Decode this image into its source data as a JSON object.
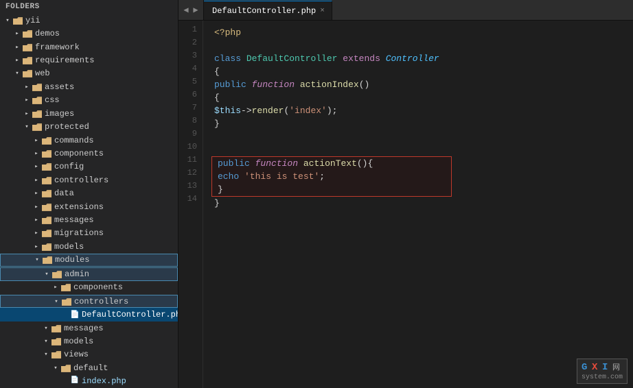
{
  "sidebar": {
    "header": "FOLDERS",
    "tree": [
      {
        "id": "yii",
        "label": "yii",
        "indent": 0,
        "type": "folder",
        "state": "expanded"
      },
      {
        "id": "demos",
        "label": "demos",
        "indent": 1,
        "type": "folder",
        "state": "collapsed"
      },
      {
        "id": "framework",
        "label": "framework",
        "indent": 1,
        "type": "folder",
        "state": "collapsed"
      },
      {
        "id": "requirements",
        "label": "requirements",
        "indent": 1,
        "type": "folder",
        "state": "collapsed"
      },
      {
        "id": "web",
        "label": "web",
        "indent": 1,
        "type": "folder",
        "state": "expanded"
      },
      {
        "id": "assets",
        "label": "assets",
        "indent": 2,
        "type": "folder",
        "state": "collapsed"
      },
      {
        "id": "css",
        "label": "css",
        "indent": 2,
        "type": "folder",
        "state": "collapsed"
      },
      {
        "id": "images",
        "label": "images",
        "indent": 2,
        "type": "folder",
        "state": "collapsed"
      },
      {
        "id": "protected",
        "label": "protected",
        "indent": 2,
        "type": "folder",
        "state": "expanded"
      },
      {
        "id": "commands",
        "label": "commands",
        "indent": 3,
        "type": "folder",
        "state": "collapsed"
      },
      {
        "id": "components",
        "label": "components",
        "indent": 3,
        "type": "folder",
        "state": "collapsed"
      },
      {
        "id": "config",
        "label": "config",
        "indent": 3,
        "type": "folder",
        "state": "collapsed"
      },
      {
        "id": "controllers",
        "label": "controllers",
        "indent": 3,
        "type": "folder",
        "state": "collapsed"
      },
      {
        "id": "data",
        "label": "data",
        "indent": 3,
        "type": "folder",
        "state": "collapsed"
      },
      {
        "id": "extensions",
        "label": "extensions",
        "indent": 3,
        "type": "folder",
        "state": "collapsed"
      },
      {
        "id": "messages",
        "label": "messages",
        "indent": 3,
        "type": "folder",
        "state": "collapsed"
      },
      {
        "id": "migrations",
        "label": "migrations",
        "indent": 3,
        "type": "folder",
        "state": "collapsed"
      },
      {
        "id": "models",
        "label": "models",
        "indent": 3,
        "type": "folder",
        "state": "collapsed"
      },
      {
        "id": "modules",
        "label": "modules",
        "indent": 3,
        "type": "folder",
        "state": "expanded",
        "highlighted": true
      },
      {
        "id": "admin",
        "label": "admin",
        "indent": 4,
        "type": "folder",
        "state": "expanded",
        "highlighted": true
      },
      {
        "id": "admin-components",
        "label": "components",
        "indent": 5,
        "type": "folder",
        "state": "collapsed"
      },
      {
        "id": "admin-controllers",
        "label": "controllers",
        "indent": 5,
        "type": "folder",
        "state": "expanded",
        "highlighted": true
      },
      {
        "id": "DefaultController.php",
        "label": "DefaultController.php",
        "indent": 6,
        "type": "file",
        "state": "leaf",
        "active": true
      },
      {
        "id": "admin-messages",
        "label": "messages",
        "indent": 4,
        "type": "folder",
        "state": "expanded"
      },
      {
        "id": "admin-models",
        "label": "models",
        "indent": 4,
        "type": "folder",
        "state": "expanded"
      },
      {
        "id": "admin-views",
        "label": "views",
        "indent": 4,
        "type": "folder",
        "state": "expanded"
      },
      {
        "id": "default",
        "label": "default",
        "indent": 5,
        "type": "folder",
        "state": "expanded"
      },
      {
        "id": "index.php",
        "label": "index.php",
        "indent": 6,
        "type": "file",
        "state": "leaf"
      }
    ]
  },
  "editor": {
    "tab_label": "DefaultController.php",
    "tab_close": "×",
    "lines": [
      {
        "num": 1,
        "code": "<?php"
      },
      {
        "num": 2,
        "code": ""
      },
      {
        "num": 3,
        "code": "class DefaultController extends Controller"
      },
      {
        "num": 4,
        "code": "{"
      },
      {
        "num": 5,
        "code": "    public function actionIndex()"
      },
      {
        "num": 6,
        "code": "    {"
      },
      {
        "num": 7,
        "code": "        $this->render('index');"
      },
      {
        "num": 8,
        "code": "    }"
      },
      {
        "num": 9,
        "code": ""
      },
      {
        "num": 10,
        "code": ""
      },
      {
        "num": 11,
        "code": "    public function actionText(){"
      },
      {
        "num": 12,
        "code": "        echo 'this is test';"
      },
      {
        "num": 13,
        "code": "    }"
      },
      {
        "num": 14,
        "code": "}"
      }
    ]
  },
  "watermark": {
    "g": "G",
    "x": "X",
    "i": "I",
    "net": "网",
    "domain": "system.com"
  }
}
